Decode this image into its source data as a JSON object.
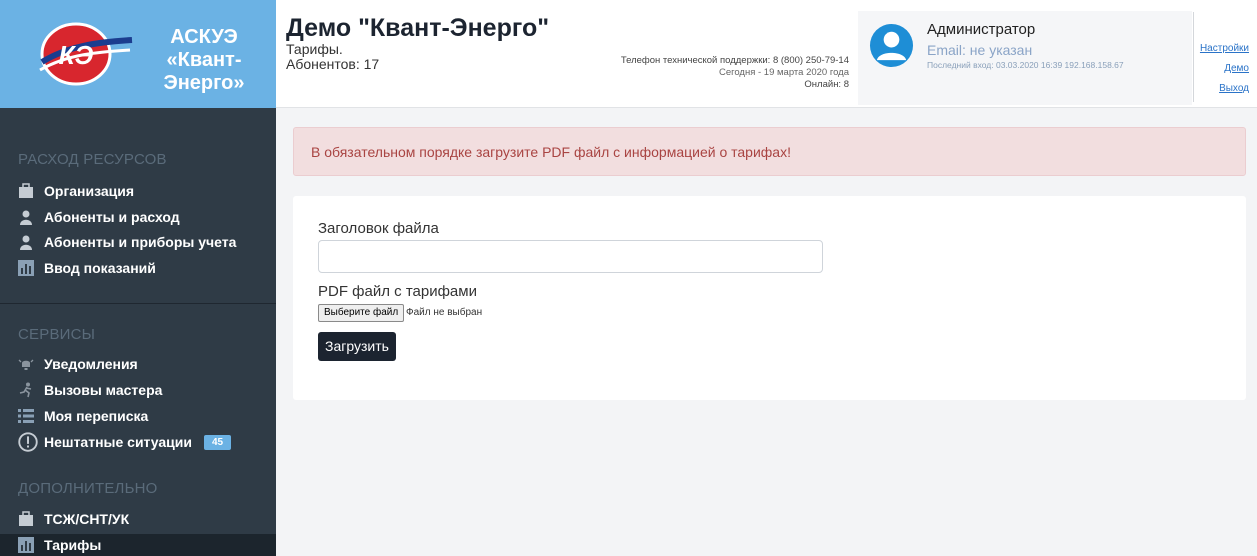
{
  "logo": {
    "text_line1": "АСКУЭ",
    "text_line2": "«Квант-",
    "text_line3": "Энерго»",
    "emblem_letters": "КЭ"
  },
  "header": {
    "title": "Демо \"Квант-Энерго\"",
    "subtitle": "Тарифы.",
    "subscribers": "Абонентов: 17",
    "support_phone": "Телефон технической поддержки: 8 (800) 250-79-14",
    "today": "Сегодня - 19 марта 2020 года",
    "online": "Онлайн: 8"
  },
  "user": {
    "name": "Администратор",
    "email": "Email: не указан",
    "last_login": "Последний вход: 03.03.2020 16:39 192.168.158.67"
  },
  "header_links": [
    "Настройки",
    "Демо",
    "Выход"
  ],
  "sidebar": {
    "sections": [
      "РАСХОД РЕСУРСОВ",
      "СЕРВИСЫ",
      "ДОПОЛНИТЕЛЬНО"
    ],
    "items": [
      {
        "label": "Организация",
        "icon": "briefcase-icon"
      },
      {
        "label": "Абоненты и расход",
        "icon": "user-icon"
      },
      {
        "label": "Абоненты и приборы учета",
        "icon": "user-icon"
      },
      {
        "label": "Ввод показаний",
        "icon": "bar-chart-icon"
      },
      {
        "label": "Уведомления",
        "icon": "bell-icon"
      },
      {
        "label": "Вызовы мастера",
        "icon": "running-person-icon"
      },
      {
        "label": "Моя переписка",
        "icon": "list-icon"
      },
      {
        "label": "Нештатные ситуации",
        "icon": "warning-circle-icon",
        "badge": "45"
      },
      {
        "label": "ТСЖ/СНТ/УК",
        "icon": "briefcase-icon"
      },
      {
        "label": "Тарифы",
        "icon": "bar-chart-icon",
        "active": true
      }
    ]
  },
  "alert": {
    "text": "В обязательном порядке загрузите PDF файл с информацией о тарифах!"
  },
  "form": {
    "title_label": "Заголовок файла",
    "title_value": "",
    "file_label": "PDF файл с тарифами",
    "file_button": "Выберите файл",
    "file_status": "Файл не выбран",
    "submit_label": "Загрузить"
  },
  "colors": {
    "logo_bg": "#6bb2e4",
    "sidebar_bg": "#2f3b46",
    "alert_bg": "#f2dedf",
    "alert_text": "#a94442",
    "accent": "#1c2430"
  }
}
